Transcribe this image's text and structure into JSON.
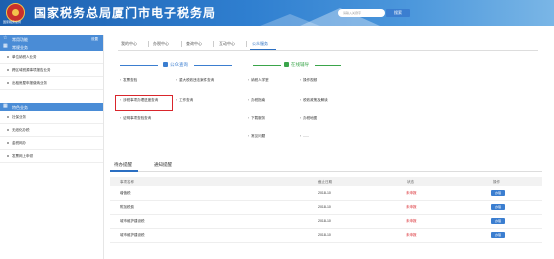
{
  "header": {
    "title": "国家税务总局厦门市电子税务局",
    "emblem_caption": "国家税务总局",
    "search_placeholder": "请输入关键字",
    "search_button": "搜索"
  },
  "sidebar": {
    "section1": {
      "label": "常用功能",
      "extra": "设置"
    },
    "section2": {
      "label": "常规业务"
    },
    "items_a": [
      "单位纳税人业务",
      "跨区域税源事项报告业务",
      "出租房屋申报缴纳业务"
    ],
    "section3": {
      "label": "特色业务"
    },
    "items_b": [
      "社保业务",
      "无纸化办税",
      "金税网办",
      "发票网上申领"
    ]
  },
  "nav": {
    "tabs": [
      "我的中心",
      "办税中心",
      "查询中心",
      "互动中心",
      "公众服务"
    ],
    "active": "公众服务"
  },
  "sections": {
    "left_title": "公众查询",
    "right_title": "在线辅导",
    "left_col1": [
      "发票查验",
      "涉税事项办理进度查询",
      "证明事项查验查询"
    ],
    "left_col2": [
      "重大税收违法案件查询",
      "工作查询"
    ],
    "right_col1": [
      "纳税人学堂",
      "办税指南",
      "下载服务",
      "常见问题"
    ],
    "right_col2": [
      "操作视频",
      "税收政策及解读",
      "办税地图",
      "......"
    ]
  },
  "bottom": {
    "tabs": [
      "待办提醒",
      "通知提醒"
    ],
    "columns": [
      "事项名称",
      "截止日期",
      "状态",
      "操作"
    ],
    "rows": [
      {
        "name": "增值税",
        "date": "2018-10",
        "status": "未申报",
        "action": "办理"
      },
      {
        "name": "附加税费",
        "date": "2018-10",
        "status": "未申报",
        "action": "办理"
      },
      {
        "name": "城市维护建设税",
        "date": "2018-10",
        "status": "未申报",
        "action": "办理"
      },
      {
        "name": "城市维护建设税",
        "date": "2018-10",
        "status": "未申报",
        "action": "办理"
      }
    ]
  },
  "colors": {
    "header": "#2f7fd0",
    "accent": "#2b6fc2",
    "warning": "#d9262c",
    "section_left": "#3b7ed0",
    "section_right": "#3aa54a"
  }
}
